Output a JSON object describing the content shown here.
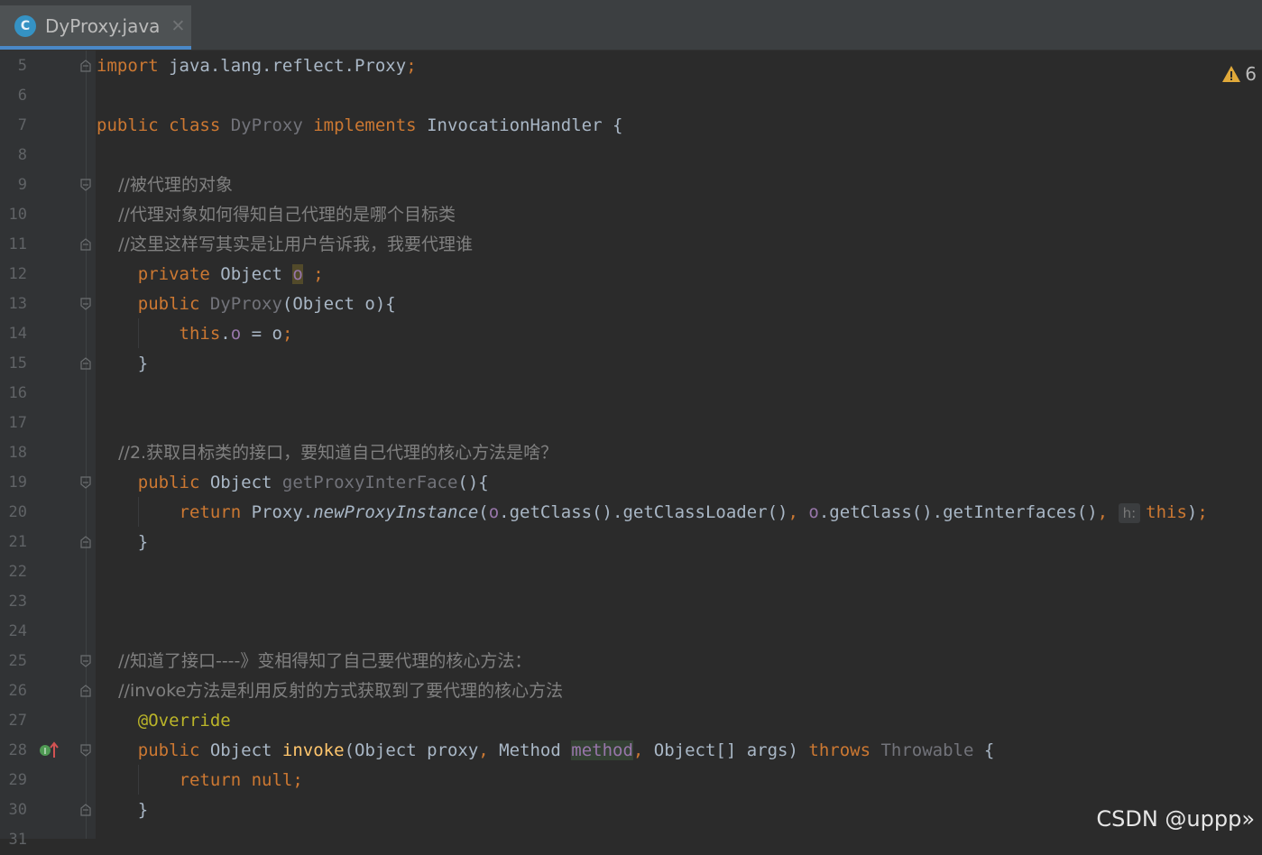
{
  "tab": {
    "title": "DyProxy.java",
    "icon_letter": "C",
    "close_glyph": "✕"
  },
  "inspection": {
    "warning_count": "6"
  },
  "lines": [
    {
      "num": "5",
      "segments": [
        [
          "kw",
          "import"
        ],
        [
          "cls",
          " java.lang.reflect.Proxy"
        ],
        [
          "kw",
          ";"
        ]
      ]
    },
    {
      "num": "6",
      "segments": []
    },
    {
      "num": "7",
      "segments": [
        [
          "kw",
          "public class "
        ],
        [
          "unused",
          "DyProxy "
        ],
        [
          "kw",
          "implements "
        ],
        [
          "cls",
          "InvocationHandler {"
        ]
      ]
    },
    {
      "num": "8",
      "segments": []
    },
    {
      "num": "9",
      "segments": [
        [
          "com",
          "    //被代理的对象"
        ]
      ]
    },
    {
      "num": "10",
      "segments": [
        [
          "com",
          "    //代理对象如何得知自己代理的是哪个目标类"
        ]
      ]
    },
    {
      "num": "11",
      "segments": [
        [
          "com",
          "    //这里这样写其实是让用户告诉我，我要代理谁"
        ]
      ]
    },
    {
      "num": "12",
      "segments": [
        [
          "kw",
          "    private "
        ],
        [
          "cls",
          "Object "
        ],
        [
          "fld hl-warn",
          "o"
        ],
        [
          "kw",
          " ;"
        ]
      ]
    },
    {
      "num": "13",
      "segments": [
        [
          "kw",
          "    public "
        ],
        [
          "unused",
          "DyProxy"
        ],
        [
          "cls",
          "(Object o){"
        ]
      ]
    },
    {
      "num": "14",
      "segments": [
        [
          "kw",
          "        this"
        ],
        [
          "cls",
          "."
        ],
        [
          "fld",
          "o"
        ],
        [
          "cls",
          " = o"
        ],
        [
          "kw",
          ";"
        ]
      ]
    },
    {
      "num": "15",
      "segments": [
        [
          "cls",
          "    }"
        ]
      ]
    },
    {
      "num": "16",
      "segments": []
    },
    {
      "num": "17",
      "segments": []
    },
    {
      "num": "18",
      "segments": [
        [
          "com",
          "    //2.获取目标类的接口，要知道自己代理的核心方法是啥？"
        ]
      ]
    },
    {
      "num": "19",
      "segments": [
        [
          "kw",
          "    public "
        ],
        [
          "cls",
          "Object "
        ],
        [
          "unused",
          "getProxyInterFace"
        ],
        [
          "cls",
          "(){"
        ]
      ]
    },
    {
      "num": "20",
      "segments": [
        [
          "kw",
          "        return "
        ],
        [
          "cls",
          "Proxy."
        ],
        [
          "ital",
          "newProxyInstance"
        ],
        [
          "cls",
          "("
        ],
        [
          "fld",
          "o"
        ],
        [
          "cls",
          ".getClass().getClassLoader()"
        ],
        [
          "kw",
          ", "
        ],
        [
          "fld",
          "o"
        ],
        [
          "cls",
          ".getClass().getInterfaces()"
        ],
        [
          "kw",
          ", "
        ],
        [
          "hint",
          "h:"
        ],
        [
          "kw",
          "this"
        ],
        [
          "cls",
          ")"
        ],
        [
          "kw",
          ";"
        ]
      ]
    },
    {
      "num": "21",
      "segments": [
        [
          "cls",
          "    }"
        ]
      ]
    },
    {
      "num": "22",
      "segments": []
    },
    {
      "num": "23",
      "segments": []
    },
    {
      "num": "24",
      "segments": []
    },
    {
      "num": "25",
      "segments": [
        [
          "com",
          "    //知道了接口----》变相得知了自己要代理的核心方法："
        ]
      ]
    },
    {
      "num": "26",
      "segments": [
        [
          "com",
          "    //invoke方法是利用反射的方式获取到了要代理的核心方法"
        ]
      ]
    },
    {
      "num": "27",
      "segments": [
        [
          "ann",
          "    @Override"
        ]
      ]
    },
    {
      "num": "28",
      "segments": [
        [
          "kw",
          "    public "
        ],
        [
          "cls",
          "Object "
        ],
        [
          "meth",
          "invoke"
        ],
        [
          "cls",
          "(Object proxy"
        ],
        [
          "kw",
          ", "
        ],
        [
          "cls",
          "Method "
        ],
        [
          "hl-method",
          "method"
        ],
        [
          "kw",
          ", "
        ],
        [
          "cls",
          "Object[] args) "
        ],
        [
          "kw",
          "throws "
        ],
        [
          "unused",
          "Throwable "
        ],
        [
          "cls",
          "{"
        ]
      ]
    },
    {
      "num": "29",
      "segments": [
        [
          "kw",
          "        return null;"
        ]
      ]
    },
    {
      "num": "30",
      "segments": [
        [
          "cls",
          "    }"
        ]
      ]
    },
    {
      "num": "31",
      "segments": []
    }
  ],
  "folds": {
    "5": "open-end",
    "9": "open",
    "11": "close",
    "13": "open",
    "15": "close",
    "19": "open",
    "21": "close",
    "25": "open",
    "26": "close",
    "28": "open",
    "30": "close"
  },
  "watermark": "CSDN @uppp»"
}
